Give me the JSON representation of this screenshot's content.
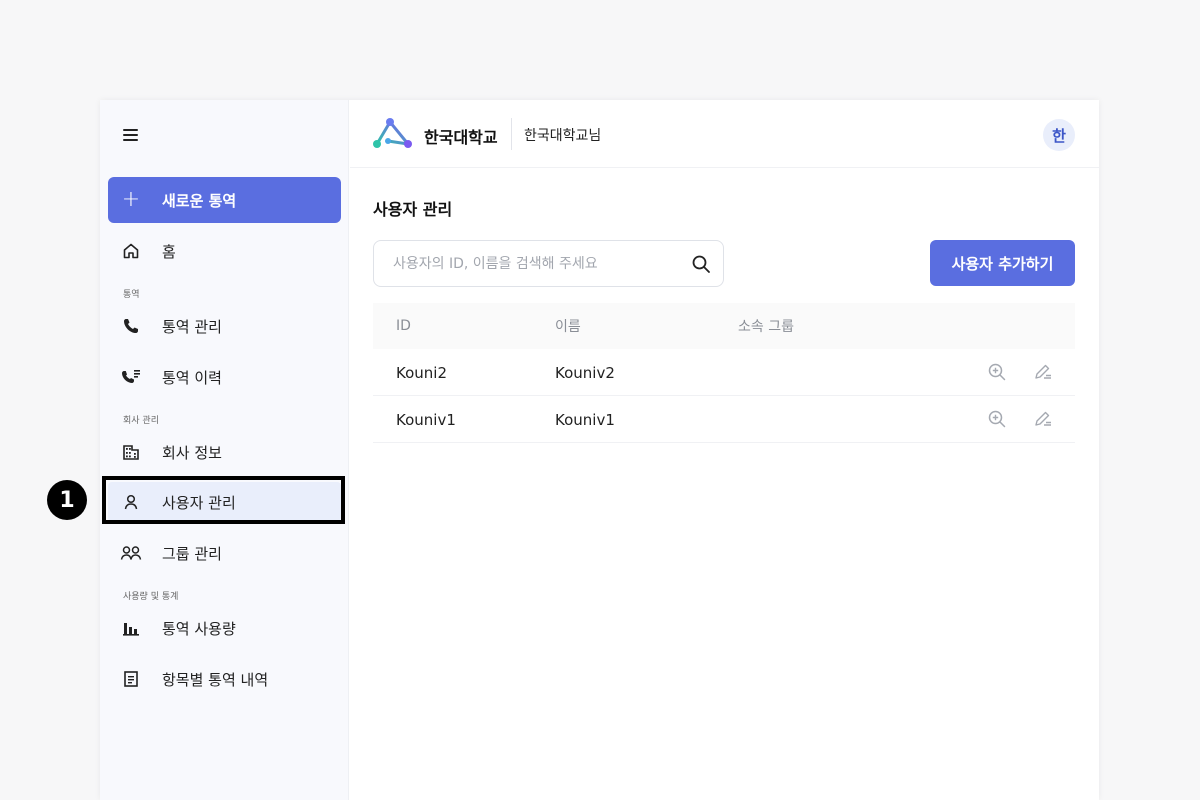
{
  "sidebar": {
    "new_call_label": "새로운 통역",
    "home_label": "홈",
    "section_interpretation": "통역",
    "call_management_label": "통역 관리",
    "call_history_label": "통역 이력",
    "section_company": "회사 관리",
    "company_info_label": "회사 정보",
    "user_management_label": "사용자 관리",
    "group_management_label": "그룹 관리",
    "section_usage": "사용량 및 통계",
    "usage_label": "통역 사용량",
    "item_details_label": "항목별 통역 내역"
  },
  "step_badge": "1",
  "header": {
    "org_name": "한국대학교",
    "user_name": "한국대학교님",
    "avatar_text": "한"
  },
  "page": {
    "title": "사용자 관리",
    "search_placeholder": "사용자의 ID, 이름을 검색해 주세요",
    "add_user_label": "사용자 추가하기"
  },
  "table": {
    "columns": [
      "ID",
      "이름",
      "소속 그룹"
    ],
    "rows": [
      {
        "id": "Kouni2",
        "name": "Kouniv2",
        "group": ""
      },
      {
        "id": "Kouniv1",
        "name": "Kouniv1",
        "group": ""
      }
    ]
  },
  "colors": {
    "accent": "#5a6ee0",
    "active_bg": "#e9eefb",
    "avatar_text": "#3c56c8"
  }
}
